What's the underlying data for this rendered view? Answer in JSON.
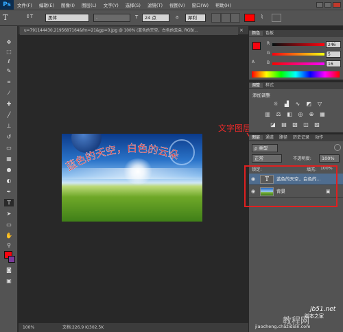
{
  "app": {
    "logo": "Ps"
  },
  "menu": [
    "文件(F)",
    "编辑(E)",
    "图像(I)",
    "图层(L)",
    "文字(Y)",
    "选择(S)",
    "滤镜(T)",
    "视图(V)",
    "窗口(W)",
    "帮助(H)"
  ],
  "options": {
    "tool_glyph": "T",
    "orient_glyph": "↕T",
    "font_family": "黑体",
    "font_style": "-",
    "font_size": "24 点",
    "anti_alias": "犀利",
    "text_color": "#ff0000"
  },
  "document": {
    "tab_title": "u=791144430,2195687164&fm=21&gp=0.jpg @ 100% (蓝色的天空，白色的云朵, RGB/...",
    "canvas_text": "蓝色的天空，白色的云朵"
  },
  "status": {
    "zoom": "100%",
    "doc_info": "文档:226.9 K/302.5K"
  },
  "color_panel": {
    "tabs": [
      "颜色",
      "色板"
    ],
    "channels": [
      {
        "label": "R",
        "value": "246"
      },
      {
        "label": "G",
        "value": "5"
      },
      {
        "label": "B",
        "value": "16"
      }
    ],
    "fg_color": "#f60510",
    "bg_color": "#ffffff"
  },
  "adjust_panel": {
    "tabs": [
      "调整",
      "样式"
    ],
    "title": "添加调整"
  },
  "layers_panel": {
    "tabs": [
      "图层",
      "通道",
      "路径",
      "历史记录",
      "动作"
    ],
    "filter_label": "ρ 类型",
    "blend_mode": "正常",
    "opacity_label": "不透明度:",
    "opacity_value": "100%",
    "lock_label": "锁定:",
    "fill_label": "填充:",
    "fill_value": "100%",
    "layers": [
      {
        "name": "蓝色的天空，白色的...",
        "kind": "text",
        "selected": true
      },
      {
        "name": "背景",
        "kind": "image",
        "selected": false
      }
    ]
  },
  "annotation": {
    "label": "文字图层",
    "color": "#ee2a2a"
  },
  "watermark": {
    "brand": "jb51.net",
    "cn": "脚本之家",
    "small": "jiaocheng.chazidian.com",
    "site_cn": "教程网"
  }
}
